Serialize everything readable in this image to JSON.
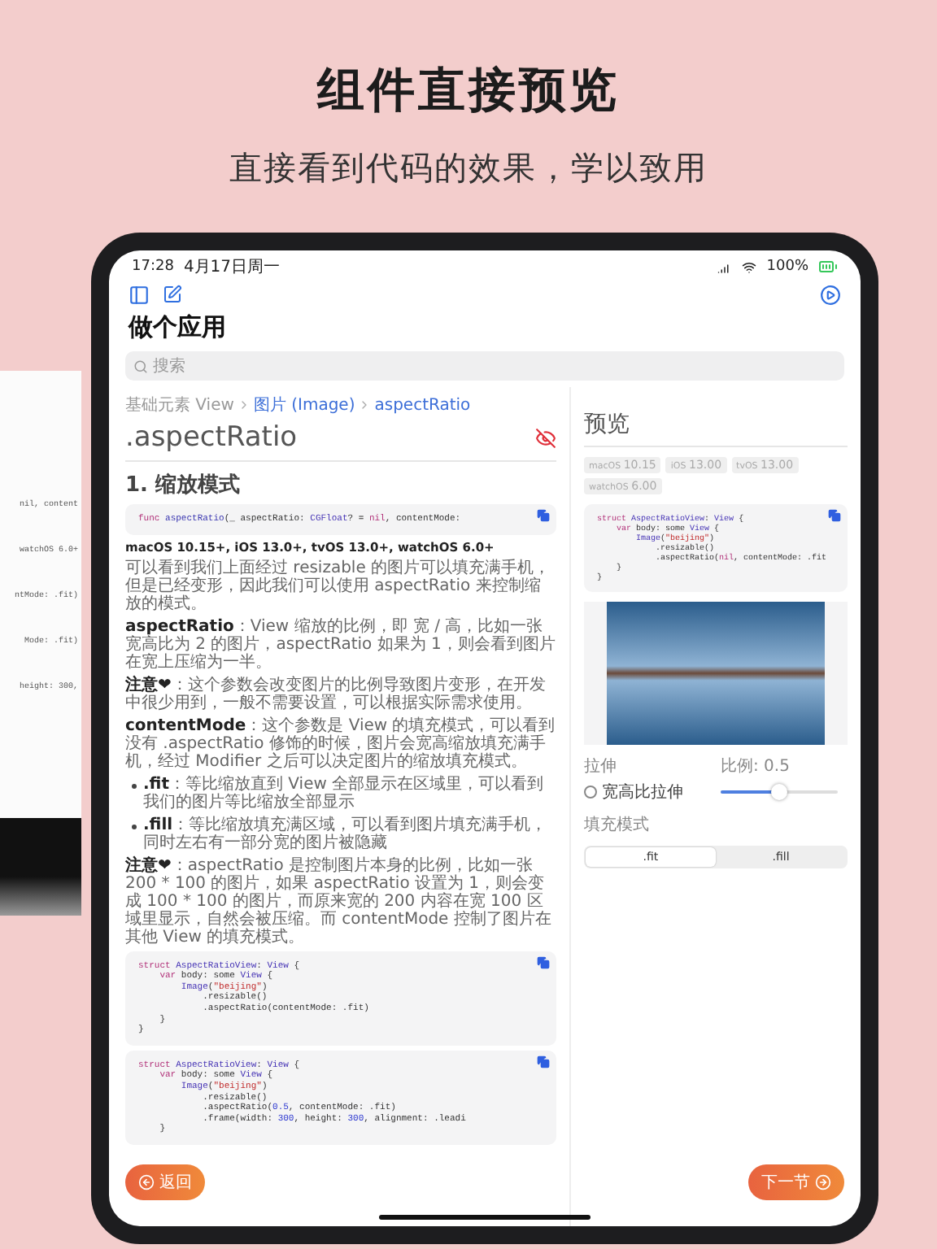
{
  "hero": {
    "title": "组件直接预览",
    "subtitle": "直接看到代码的效果，学以致用"
  },
  "laptop": {
    "lines": [
      "nil, content",
      "watchOS 6.0+",
      "ntMode: .fit)",
      "Mode: .fit)",
      "height: 300,"
    ]
  },
  "status_bar": {
    "time": "17:28",
    "date": "4月17日周一",
    "battery": "100%"
  },
  "sidebar": {
    "title": "做个应用",
    "search": {
      "placeholder": "搜索"
    }
  },
  "article": {
    "breadcrumb": [
      {
        "label": "基础元素 View",
        "link": false
      },
      {
        "label": "图片 (Image)",
        "link": true
      },
      {
        "label": "aspectRatio",
        "link": true
      }
    ],
    "title": ".aspectRatio",
    "section": "1. 缩放模式",
    "signature": [
      [
        {
          "kind": "kw",
          "text": "func "
        },
        {
          "kind": "fn",
          "text": "aspectRatio"
        },
        {
          "kind": "plain",
          "text": "(_ aspectRatio: "
        },
        {
          "kind": "type",
          "text": "CGFloat"
        },
        {
          "kind": "plain",
          "text": "? = "
        },
        {
          "kind": "kw",
          "text": "nil"
        },
        {
          "kind": "plain",
          "text": ", contentMode:"
        }
      ]
    ],
    "platforms": "macOS 10.15+, iOS 13.0+, tvOS 13.0+, watchOS 6.0+",
    "blocks": [
      {
        "kind": "paragraph",
        "text": "可以看到我们上面经过 resizable 的图片可以填充满手机，但是已经变形，因此我们可以使用 aspectRatio 来控制缩放的模式。"
      },
      {
        "kind": "paragraph",
        "text": "**aspectRatio**：View 缩放的比例，即 宽 / 高，比如一张宽高比为 2 的图片，aspectRatio 如果为 1，则会看到图片在宽上压缩为一半。"
      },
      {
        "kind": "paragraph",
        "text": "**注意❤**：这个参数会改变图片的比例导致图片变形，在开发中很少用到，一般不需要设置，可以根据实际需求使用。"
      },
      {
        "kind": "paragraph",
        "text": "**contentMode**：这个参数是 View 的填充模式，可以看到没有 .aspectRatio 修饰的时候，图片会宽高缩放填充满手机，经过 Modifier 之后可以决定图片的缩放填充模式。"
      },
      {
        "kind": "bullet",
        "text": "**.fit**：等比缩放直到 View 全部显示在区域里，可以看到我们的图片等比缩放全部显示"
      },
      {
        "kind": "bullet",
        "text": "**.fill**：等比缩放填充满区域，可以看到图片填充满手机，同时左右有一部分宽的图片被隐藏"
      },
      {
        "kind": "paragraph",
        "text": "**注意❤**：aspectRatio 是控制图片本身的比例，比如一张 200 * 100 的图片，如果 aspectRatio 设置为 1，则会变成 100 * 100 的图片，而原来宽的 200 内容在宽 100 区域里显示，自然会被压缩。而 contentMode 控制了图片在其他 View 的填充模式。"
      },
      {
        "kind": "code",
        "lines": [
          [
            {
              "kind": "kw",
              "text": "struct "
            },
            {
              "kind": "type",
              "text": "AspectRatioView"
            },
            {
              "kind": "plain",
              "text": ": "
            },
            {
              "kind": "type",
              "text": "View"
            },
            {
              "kind": "plain",
              "text": " {"
            }
          ],
          [
            {
              "kind": "kw",
              "text": "    var "
            },
            {
              "kind": "plain",
              "text": "body: some "
            },
            {
              "kind": "type",
              "text": "View"
            },
            {
              "kind": "plain",
              "text": " {"
            }
          ],
          [
            {
              "kind": "type",
              "text": "        Image"
            },
            {
              "kind": "plain",
              "text": "("
            },
            {
              "kind": "str",
              "text": "\"beijing\""
            },
            {
              "kind": "plain",
              "text": ")"
            }
          ],
          [
            {
              "kind": "plain",
              "text": "            .resizable()"
            }
          ],
          [
            {
              "kind": "plain",
              "text": "            .aspectRatio(contentMode: .fit)"
            }
          ],
          [
            {
              "kind": "plain",
              "text": "    }"
            }
          ],
          [
            {
              "kind": "plain",
              "text": "}"
            }
          ]
        ]
      },
      {
        "kind": "code",
        "lines": [
          [
            {
              "kind": "kw",
              "text": "struct "
            },
            {
              "kind": "type",
              "text": "AspectRatioView"
            },
            {
              "kind": "plain",
              "text": ": "
            },
            {
              "kind": "type",
              "text": "View"
            },
            {
              "kind": "plain",
              "text": " {"
            }
          ],
          [
            {
              "kind": "kw",
              "text": "    var "
            },
            {
              "kind": "plain",
              "text": "body: some "
            },
            {
              "kind": "type",
              "text": "View"
            },
            {
              "kind": "plain",
              "text": " {"
            }
          ],
          [
            {
              "kind": "type",
              "text": "        Image"
            },
            {
              "kind": "plain",
              "text": "("
            },
            {
              "kind": "str",
              "text": "\"beijing\""
            },
            {
              "kind": "plain",
              "text": ")"
            }
          ],
          [
            {
              "kind": "plain",
              "text": "            .resizable()"
            }
          ],
          [
            {
              "kind": "plain",
              "text": "            .aspectRatio("
            },
            {
              "kind": "num",
              "text": "0.5"
            },
            {
              "kind": "plain",
              "text": ", contentMode: .fit)"
            }
          ],
          [
            {
              "kind": "plain",
              "text": "            .frame(width: "
            },
            {
              "kind": "num",
              "text": "300"
            },
            {
              "kind": "plain",
              "text": ", height: "
            },
            {
              "kind": "num",
              "text": "300"
            },
            {
              "kind": "plain",
              "text": ", alignment: .leadi"
            }
          ],
          [
            {
              "kind": "plain",
              "text": "    }"
            }
          ]
        ]
      }
    ]
  },
  "preview": {
    "title": "预览",
    "versions": [
      {
        "os": "macOS",
        "version": "10.15"
      },
      {
        "os": "iOS",
        "version": "13.00"
      },
      {
        "os": "tvOS",
        "version": "13.00"
      },
      {
        "os": "watchOS",
        "version": "6.00"
      }
    ],
    "code": [
      [
        {
          "kind": "kw",
          "text": "struct "
        },
        {
          "kind": "type",
          "text": "AspectRatioView"
        },
        {
          "kind": "plain",
          "text": ": "
        },
        {
          "kind": "type",
          "text": "View"
        },
        {
          "kind": "plain",
          "text": " {"
        }
      ],
      [
        {
          "kind": "kw",
          "text": "    var "
        },
        {
          "kind": "plain",
          "text": "body: some "
        },
        {
          "kind": "type",
          "text": "View"
        },
        {
          "kind": "plain",
          "text": " {"
        }
      ],
      [
        {
          "kind": "type",
          "text": "        Image"
        },
        {
          "kind": "plain",
          "text": "("
        },
        {
          "kind": "str",
          "text": "\"beijing\""
        },
        {
          "kind": "plain",
          "text": ")"
        }
      ],
      [
        {
          "kind": "plain",
          "text": "            .resizable()"
        }
      ],
      [
        {
          "kind": "plain",
          "text": "            .aspectRatio("
        },
        {
          "kind": "kw",
          "text": "nil"
        },
        {
          "kind": "plain",
          "text": ", contentMode: .fit"
        }
      ],
      [
        {
          "kind": "plain",
          "text": "    }"
        }
      ],
      [
        {
          "kind": "plain",
          "text": "}"
        }
      ]
    ],
    "controls": {
      "stretch_label": "拉伸",
      "aspect_fill": {
        "label": "宽高比拉伸",
        "checked": false
      },
      "ratio": {
        "label": "比例: 0.5",
        "level": 0.5
      },
      "fill_mode": {
        "label": "填充模式",
        "options": [
          {
            "label": ".fit",
            "selected": true
          },
          {
            "label": ".fill",
            "selected": false
          }
        ]
      }
    }
  },
  "nav": {
    "back": "返回",
    "next": "下一节"
  }
}
